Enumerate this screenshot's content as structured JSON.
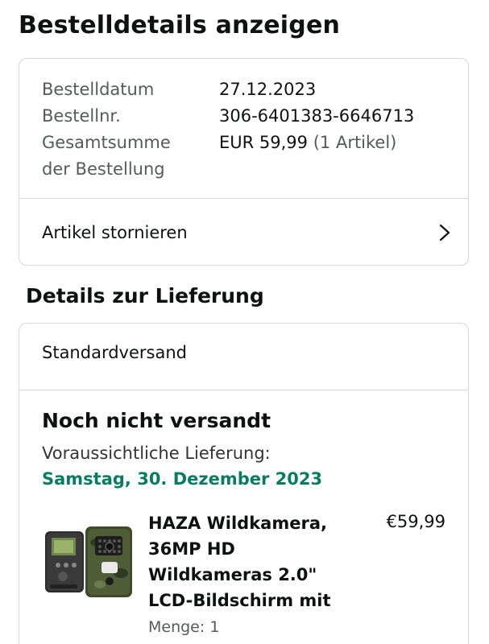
{
  "page": {
    "title": "Bestelldetails anzeigen"
  },
  "summary": {
    "order_date_label": "Bestelldatum",
    "order_date": "27.12.2023",
    "order_number_label": "Bestellnr.",
    "order_number": "306-6401383-6646713",
    "total_label_line1": "Gesamtsumme",
    "total_label_line2": "der Bestellung",
    "total_amount": "EUR 59,99",
    "total_items": "(1 Artikel)"
  },
  "cancel": {
    "label": "Artikel stornieren",
    "icon": "chevron-right-icon"
  },
  "delivery": {
    "section_title": "Details zur Lieferung",
    "shipping_method": "Standardversand",
    "status": "Noch nicht versandt",
    "eta_label": "Voraussichtliche Lieferung:",
    "eta_date": "Samstag, 30. Dezember 2023",
    "eta_color": "#067d62"
  },
  "product": {
    "title_lines": [
      "HAZA Wildkamera,",
      "36MP HD",
      "Wildkameras 2.0\"",
      "LCD-Bildschirm mit"
    ],
    "price": "€59,99",
    "quantity": "Menge: 1",
    "image_icon": "trail-camera-image"
  }
}
